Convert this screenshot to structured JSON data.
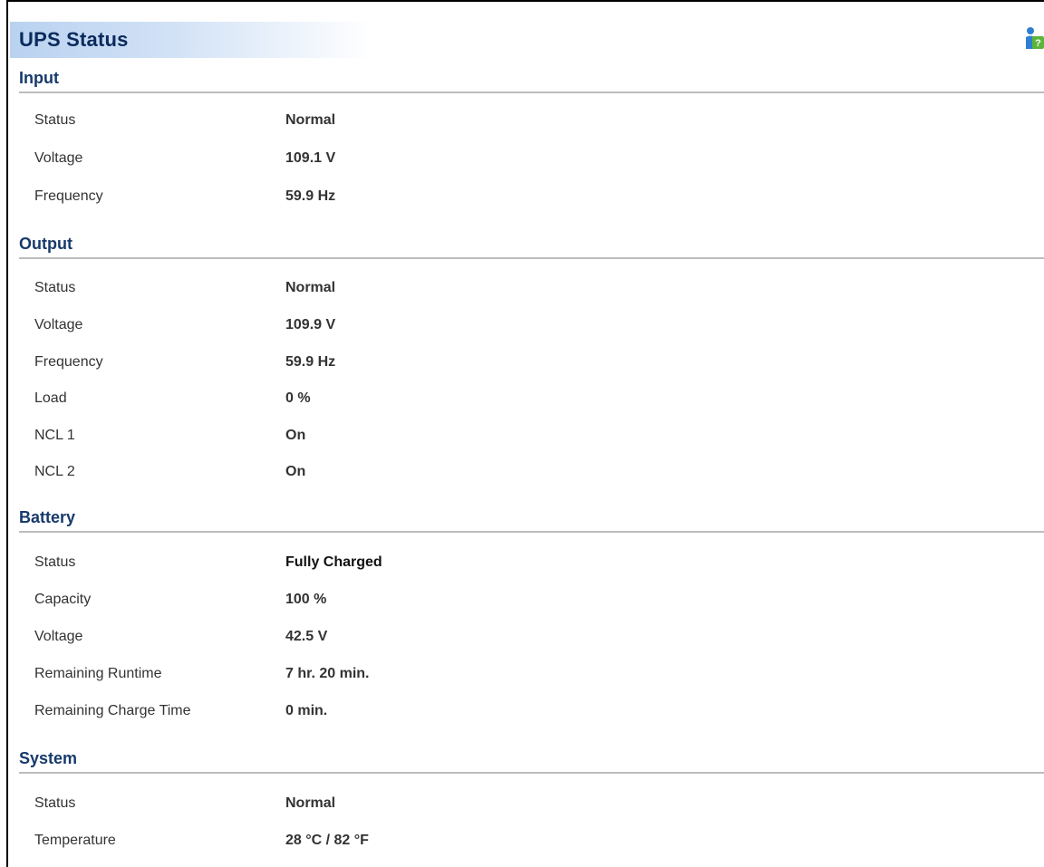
{
  "page": {
    "title": "UPS Status",
    "help_icon": "help-person-icon"
  },
  "sections": [
    {
      "heading": "Input",
      "rows": [
        {
          "label": "Status",
          "value": "Normal"
        },
        {
          "label": "Voltage",
          "value": "109.1 V"
        },
        {
          "label": "Frequency",
          "value": "59.9 Hz"
        }
      ]
    },
    {
      "heading": "Output",
      "rows": [
        {
          "label": "Status",
          "value": "Normal"
        },
        {
          "label": "Voltage",
          "value": "109.9 V"
        },
        {
          "label": "Frequency",
          "value": "59.9 Hz"
        },
        {
          "label": "Load",
          "value": "0 %"
        },
        {
          "label": "NCL 1",
          "value": "On"
        },
        {
          "label": "NCL 2",
          "value": "On"
        }
      ]
    },
    {
      "heading": "Battery",
      "rows": [
        {
          "label": "Status",
          "value": "Fully Charged"
        },
        {
          "label": "Capacity",
          "value": "100 %"
        },
        {
          "label": "Voltage",
          "value": "42.5 V"
        },
        {
          "label": "Remaining Runtime",
          "value": "7 hr. 20 min."
        },
        {
          "label": "Remaining Charge Time",
          "value": "0 min."
        }
      ]
    },
    {
      "heading": "System",
      "rows": [
        {
          "label": "Status",
          "value": "Normal"
        },
        {
          "label": "Temperature",
          "value": "28 °C / 82 °F"
        }
      ]
    }
  ],
  "colors": {
    "title_text": "#0b2a5c",
    "section_heading": "#173a6b",
    "divider": "#bcbcbc",
    "title_gradient_start": "#b9d2f0"
  }
}
